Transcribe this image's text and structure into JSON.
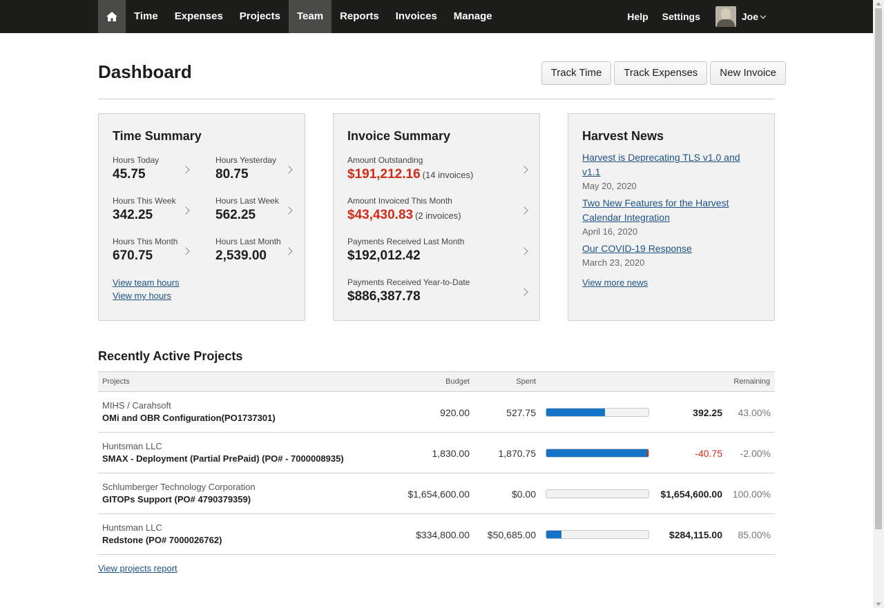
{
  "nav": {
    "home_icon": "home-icon",
    "items": [
      "Time",
      "Expenses",
      "Projects",
      "Team",
      "Reports",
      "Invoices",
      "Manage"
    ],
    "active": "Team",
    "help": "Help",
    "settings": "Settings",
    "user_name": "Joe"
  },
  "page": {
    "title": "Dashboard",
    "actions": [
      "Track Time",
      "Track Expenses",
      "New Invoice"
    ]
  },
  "time_summary": {
    "title": "Time Summary",
    "metrics": [
      {
        "label": "Hours Today",
        "value": "45.75"
      },
      {
        "label": "Hours Yesterday",
        "value": "80.75"
      },
      {
        "label": "Hours This Week",
        "value": "342.25"
      },
      {
        "label": "Hours Last Week",
        "value": "562.25"
      },
      {
        "label": "Hours This Month",
        "value": "670.75"
      },
      {
        "label": "Hours Last Month",
        "value": "2,539.00"
      }
    ],
    "links": [
      "View team hours",
      "View my hours"
    ]
  },
  "invoice_summary": {
    "title": "Invoice Summary",
    "metrics": [
      {
        "label": "Amount Outstanding",
        "value": "$191,212.16",
        "sub": "(14 invoices)"
      },
      {
        "label": "Amount Invoiced This Month",
        "value": "$43,430.83",
        "sub": "(2 invoices)"
      },
      {
        "label": "Payments Received Last Month",
        "value": "$192,012.42"
      },
      {
        "label": "Payments Received Year-to-Date",
        "value": "$886,387.78"
      }
    ]
  },
  "news": {
    "title": "Harvest News",
    "items": [
      {
        "title": "Harvest is Deprecating TLS v1.0 and v1.1",
        "date": "May 20, 2020"
      },
      {
        "title": "Two New Features for the Harvest Calendar Integration",
        "date": "April 16, 2020"
      },
      {
        "title": "Our COVID-19 Response",
        "date": "March 23, 2020"
      }
    ],
    "more": "View more news"
  },
  "projects": {
    "title": "Recently Active Projects",
    "columns": {
      "name": "Projects",
      "budget": "Budget",
      "spent": "Spent",
      "remaining": "Remaining"
    },
    "rows": [
      {
        "client": "MIHS / Carahsoft",
        "name": "OMi and OBR Configuration(PO1737301)",
        "budget": "920.00",
        "spent": "527.75",
        "progress": 0.5736,
        "over": false,
        "remaining": "392.25",
        "pct": "43.00%"
      },
      {
        "client": "Huntsman LLC",
        "name": "SMAX - Deployment (Partial PrePaid) (PO# - 7000008935)",
        "budget": "1,830.00",
        "spent": "1,870.75",
        "progress": 1.0,
        "over": true,
        "remaining": "-40.75",
        "pct": "-2.00%"
      },
      {
        "client": "Schlumberger Technology Corporation",
        "name": "GITOPs Support (PO# 4790379359)",
        "budget": "$1,654,600.00",
        "spent": "$0.00",
        "progress": 0.0,
        "over": false,
        "remaining": "$1,654,600.00",
        "pct": "100.00%"
      },
      {
        "client": "Huntsman LLC",
        "name": "Redstone (PO# 7000026762)",
        "budget": "$334,800.00",
        "spent": "$50,685.00",
        "progress": 0.1514,
        "over": false,
        "remaining": "$284,115.00",
        "pct": "85.00%"
      }
    ],
    "report_link": "View projects report"
  },
  "colors": {
    "accent": "#1473c7",
    "negative": "#d22b17",
    "link": "#1d5285",
    "topbar": "#1d1e1c"
  }
}
